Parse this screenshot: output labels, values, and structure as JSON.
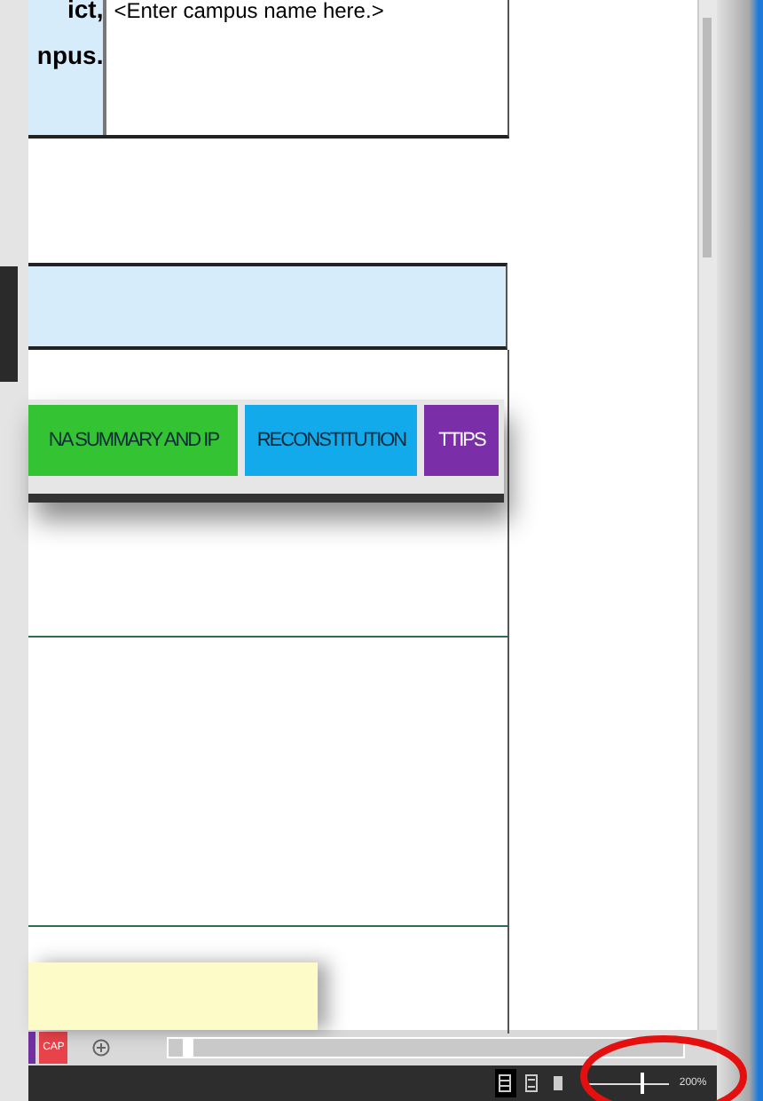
{
  "table": {
    "label_lines": [
      "ict,",
      "npus."
    ],
    "campus_placeholder": "<Enter campus name here.>"
  },
  "toolbar_buttons": [
    {
      "label": "NA SUMMARY AND IP",
      "color": "#33c333"
    },
    {
      "label": "RECONSTITUTION",
      "color": "#12aaeb"
    },
    {
      "label": "TTIPS",
      "color": "#7a2fa8"
    }
  ],
  "sheet_tabs": [
    {
      "color": "#7030a0"
    },
    {
      "label": "CAP",
      "color": "#e8434a"
    }
  ],
  "status_bar": {
    "views": [
      {
        "kind": "normal",
        "selected": true
      },
      {
        "kind": "page-layout",
        "selected": false
      },
      {
        "kind": "page-break",
        "selected": false
      }
    ],
    "zoom": {
      "level": 0.65,
      "reading": "200%"
    }
  }
}
